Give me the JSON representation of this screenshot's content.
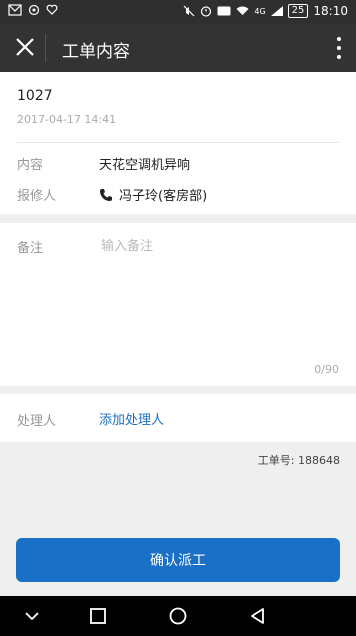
{
  "status_bar": {
    "time": "18:10",
    "battery": "25",
    "network": "4G"
  },
  "app_bar": {
    "title": "工单内容"
  },
  "order": {
    "id": "1027",
    "time": "2017-04-17 14:41",
    "content_label": "内容",
    "content_value": "天花空调机异响",
    "reporter_label": "报修人",
    "reporter_value": "冯子玲(客房部)"
  },
  "remark": {
    "label": "备注",
    "placeholder": "输入备注",
    "counter": "0/90"
  },
  "handler": {
    "label": "处理人",
    "link": "添加处理人"
  },
  "work_number": {
    "text": "工单号: 188648"
  },
  "confirm": {
    "label": "确认派工"
  },
  "colors": {
    "accent": "#1a6fc6",
    "link": "#1e6fc2",
    "app_bar": "#333333"
  }
}
